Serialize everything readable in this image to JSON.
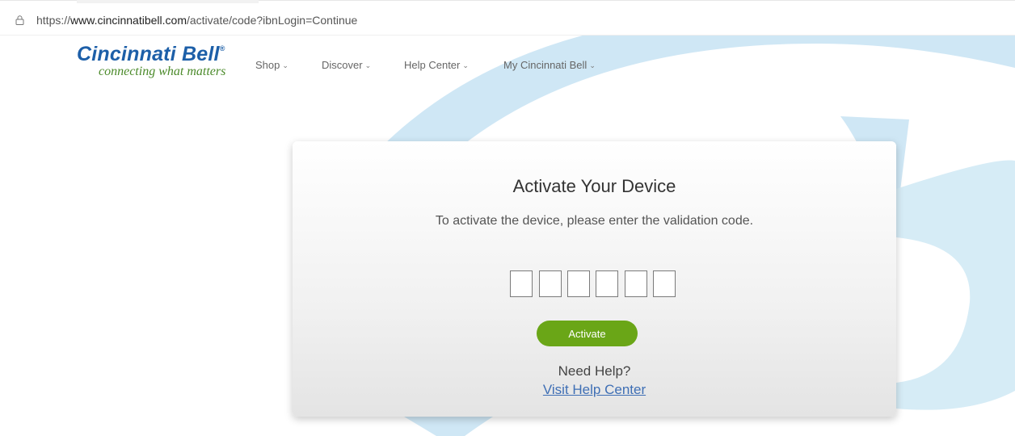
{
  "browser": {
    "url_prefix": "https://",
    "url_host": "www.cincinnatibell.com",
    "url_path": "/activate/code?ibnLogin=Continue",
    "lock_icon": "lock-icon"
  },
  "header": {
    "logo_name": "Cincinnati Bell",
    "logo_mark": "®",
    "logo_tagline": "connecting what matters",
    "nav": [
      {
        "label": "Shop",
        "icon": "chevron-down-icon"
      },
      {
        "label": "Discover",
        "icon": "chevron-down-icon"
      },
      {
        "label": "Help Center",
        "icon": "chevron-down-icon"
      },
      {
        "label": "My Cincinnati Bell",
        "icon": "chevron-down-icon"
      }
    ]
  },
  "card": {
    "title": "Activate Your Device",
    "subtitle": "To activate the device, please enter the validation code.",
    "code_values": [
      "",
      "",
      "",
      "",
      "",
      ""
    ],
    "activate_label": "Activate",
    "need_help": "Need Help?",
    "help_link": "Visit Help Center"
  },
  "colors": {
    "brand_blue": "#1d5fa8",
    "brand_green": "#4b8a2a",
    "button_green": "#6aa617",
    "link_blue": "#3f6fb5",
    "arc_blue": "#cde6f4"
  }
}
